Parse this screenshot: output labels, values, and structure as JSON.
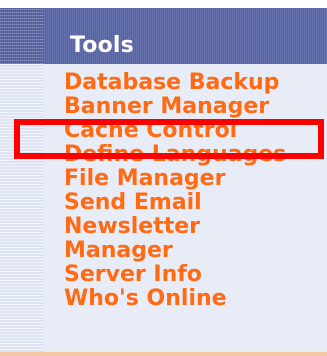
{
  "header": {
    "title": "Tools"
  },
  "menu": {
    "items": [
      {
        "label": "Database Backup"
      },
      {
        "label": "Banner Manager"
      },
      {
        "label": "Cache Control"
      },
      {
        "label": "Define Languages"
      },
      {
        "label": "File Manager"
      },
      {
        "label": "Send Email"
      },
      {
        "label": "Newsletter"
      },
      {
        "label": "Manager"
      },
      {
        "label": "Server Info"
      },
      {
        "label": "Who's Online"
      }
    ]
  },
  "colors": {
    "header_bg": "#5b67a6",
    "link_color": "#ff6a13",
    "highlight": "#ff0000",
    "panel_bg": "#e8ecf7"
  }
}
